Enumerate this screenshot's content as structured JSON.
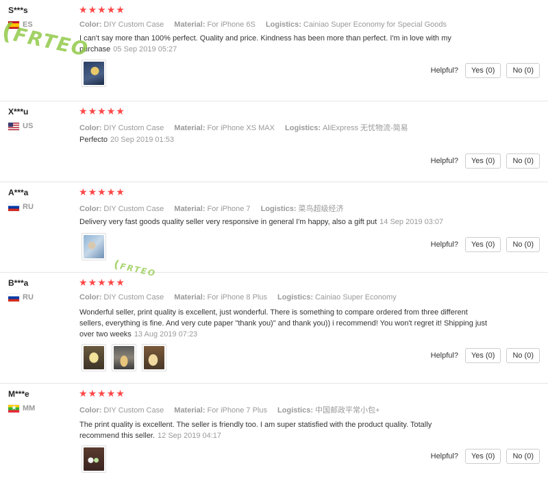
{
  "labels": {
    "color": "Color:",
    "material": "Material:",
    "logistics": "Logistics:",
    "helpful": "Helpful?",
    "yes": "Yes (0)",
    "no": "No (0)"
  },
  "watermark": {
    "text": "FRTEO",
    "color": "#8cc63f"
  },
  "accent_colors": {
    "star": "#ff4747",
    "meta_gray": "#999999"
  },
  "reviews": [
    {
      "user": "S***s",
      "country": "ES",
      "rating": 5,
      "color": "DIY Custom Case",
      "material": "For iPhone 6S",
      "logistics": "Cainiao Super Economy for Special Goods",
      "text": "I can't say more than 100% perfect. Quality and price. Kindness has been more than perfect. I'm in love with my purchase",
      "date": "05 Sep 2019 05:27"
    },
    {
      "user": "X***u",
      "country": "US",
      "rating": 5,
      "color": "DIY Custom Case",
      "material": "For iPhone XS MAX",
      "logistics": "AliExpress 无忧物流-简易",
      "text": "Perfecto",
      "date": "20 Sep 2019 01:53"
    },
    {
      "user": "A***a",
      "country": "RU",
      "rating": 5,
      "color": "DIY Custom Case",
      "material": "For iPhone 7",
      "logistics": "菜鸟超级经济",
      "text": "Delivery very fast goods quality seller very responsive in general I'm happy, also a gift put",
      "date": "14 Sep 2019 03:07"
    },
    {
      "user": "B***a",
      "country": "RU",
      "rating": 5,
      "color": "DIY Custom Case",
      "material": "For iPhone 8 Plus",
      "logistics": "Cainiao Super Economy",
      "text": "Wonderful seller, print quality is excellent, just wonderful. There is something to compare ordered from three different sellers, everything is fine. And very cute paper \"thank you)\" and thank you)) i recommend! You won't regret it! Shipping just over two weeks",
      "date": "13 Aug 2019 07:23"
    },
    {
      "user": "M***e",
      "country": "MM",
      "rating": 5,
      "color": "DIY Custom Case",
      "material": "For iPhone 7 Plus",
      "logistics": "中国邮政平常小包+",
      "text": "The print quality is excellent. The seller is friendly too. I am super statisfied with the product quality. Totally recommend this seller.",
      "date": "12 Sep 2019 04:17"
    }
  ]
}
